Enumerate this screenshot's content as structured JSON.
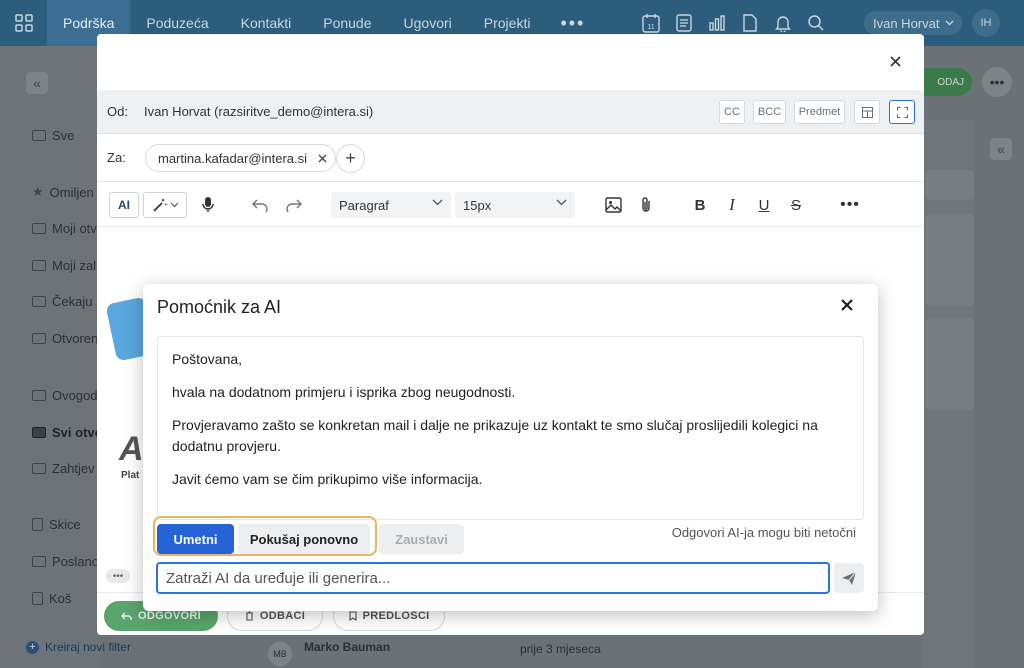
{
  "topnav": {
    "items": [
      "Podrška",
      "Poduzeća",
      "Kontakti",
      "Ponude",
      "Ugovori",
      "Projekti"
    ],
    "more": "•••",
    "user_name": "Ivan Horvat",
    "user_initials": "IH",
    "calendar_day": "11"
  },
  "sidebar": {
    "items": [
      "Sve",
      "Omiljen",
      "Moji otvo",
      "Moji zal",
      "Čekaju",
      "Otvoren",
      "Ovogod",
      "Svi otvo",
      "Zahtjev",
      "Skice",
      "Poslano",
      "Koš"
    ],
    "new_filter": "Kreiraj novi filter"
  },
  "right": {
    "action_label": "ODAJ"
  },
  "email": {
    "from_label": "Od:",
    "from_value": "Ivan  Horvat (razsiritve_demo@intera.si)",
    "cc": "CC",
    "bcc": "BCC",
    "subject_btn": "Predmet",
    "to_label": "Za:",
    "to_chip": "martina.kafadar@intera.si",
    "toolbar": {
      "ai_label": "AI",
      "paragraph": "Paragraf",
      "font_size": "15px"
    },
    "footer": {
      "reply": "ODGOVORI",
      "discard": "ODBACI",
      "templates": "PREDLOŠCI"
    }
  },
  "background_row": {
    "name": "Marko Bauman",
    "initials": "MB",
    "time": "prije 3 mjeseca"
  },
  "ai_assistant": {
    "title": "Pomoćnik za AI",
    "paragraphs": [
      "Poštovana,",
      "hvala na dodatnom primjeru i isprika zbog neugodnosti.",
      "Provjeravamo zašto se konkretan mail i dalje ne prikazuje uz kontakt te smo slučaj proslijedili kolegici na dodatnu provjeru.",
      "Javit ćemo vam se čim prikupimo više informacija."
    ],
    "insert_button": "Umetni",
    "retry_button": "Pokušaj ponovno",
    "stop_button": "Zaustavi",
    "disclaimer": "Odgovori AI-ja mogu biti netočni",
    "prompt_placeholder": "Zatraži AI da uređuje ili generira...",
    "prompt_value": ""
  },
  "colors": {
    "accent_blue": "#2563d6",
    "highlight_orange": "#e9b466",
    "reply_green": "#5aa56d"
  }
}
